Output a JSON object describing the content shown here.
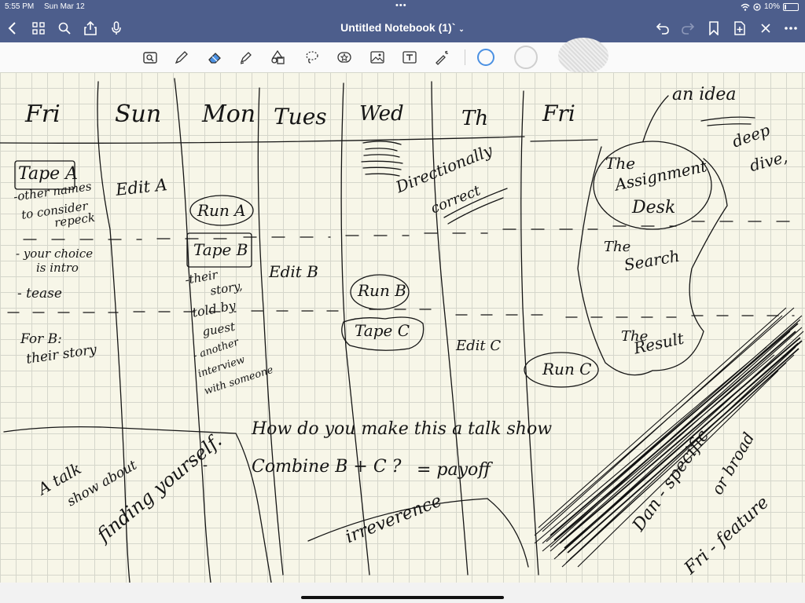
{
  "status_bar": {
    "time": "5:55 PM",
    "date": "Sun Mar 12",
    "battery": "10%"
  },
  "nav_bar": {
    "title": "Untitled Notebook (1)`",
    "left_icons": [
      "back-icon",
      "grid-icon",
      "search-icon",
      "share-icon",
      "microphone-icon"
    ],
    "right_icons": [
      "undo-icon",
      "redo-icon",
      "bookmark-icon",
      "add-page-icon",
      "close-icon",
      "more-icon"
    ]
  },
  "toolbar": {
    "tools": [
      "lasso-zoom-icon",
      "pen-icon",
      "eraser-icon",
      "highlighter-icon",
      "shapes-icon",
      "lasso-icon",
      "sticker-icon",
      "image-icon",
      "text-icon",
      "laser-icon"
    ],
    "active_tool": "eraser-icon",
    "accent_color": "#4a90e2"
  },
  "notes": {
    "days": [
      "Fri",
      "Sun",
      "Mon",
      "Tues",
      "Wed",
      "Th",
      "Fri"
    ],
    "col_fri": [
      "Tape A",
      "-other names",
      "to consider",
      "repeck",
      "- your choice",
      "is intro",
      "- tease",
      "For B:",
      "their story"
    ],
    "col_sun": [
      "Edit A"
    ],
    "col_mon": [
      "Run A",
      "Tape B",
      "-their",
      "story,",
      "told by",
      "guest",
      "- another",
      "interview",
      "with someone"
    ],
    "col_tues": [
      "Edit B"
    ],
    "col_wed": [
      "Directionally",
      "correct",
      "Run B",
      "Tape C"
    ],
    "col_th": [
      "Edit C"
    ],
    "col_fri2": [
      "Run C"
    ],
    "right": [
      "an idea",
      "deep",
      "dive,",
      "The",
      "Assignment",
      "Desk",
      "The",
      "Search",
      "The",
      "Result"
    ],
    "bottom": [
      "A talk",
      "show about",
      "finding yourself.",
      "-",
      "How do you make this a talk show",
      "Combine B + C ?",
      "= payoff",
      "irreverence",
      "Dan - specific",
      "or broad",
      "Fri - feature"
    ]
  },
  "colors": {
    "nav": "#4d5e8c",
    "paper": "#f7f6e8",
    "grid": "#d5d6cb",
    "ink": "#151515"
  }
}
